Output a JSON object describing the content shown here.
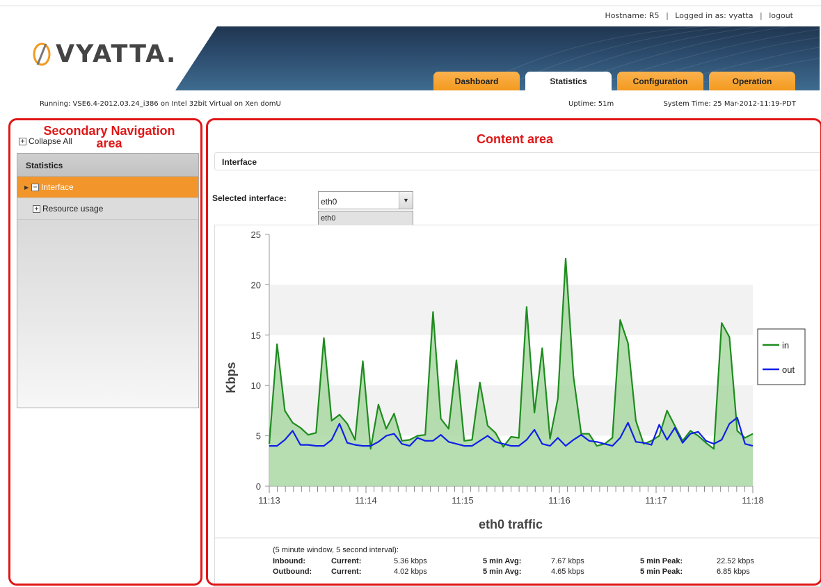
{
  "header": {
    "hostname": "Hostname: R5",
    "logged_in": "Logged in as: vyatta",
    "logout": "logout",
    "logo_text": "VYATTA.",
    "tabs": [
      {
        "label": "Dashboard",
        "active": false
      },
      {
        "label": "Statistics",
        "active": true
      },
      {
        "label": "Configuration",
        "active": false
      },
      {
        "label": "Operation",
        "active": false
      }
    ]
  },
  "status": {
    "running": "Running: VSE6.4-2012.03.24_i386 on Intel 32bit Virtual on Xen domU",
    "uptime": "Uptime: 51m",
    "system_time": "System Time: 25 Mar-2012-11:19-PDT"
  },
  "annotations": {
    "secondary_nav": "Secondary Navigation area",
    "content_area": "Content area"
  },
  "sidebar": {
    "collapse_all": "Collapse All",
    "heading": "Statistics",
    "items": [
      {
        "label": "Interface",
        "active": true
      },
      {
        "label": "Resource usage",
        "active": false
      }
    ]
  },
  "content": {
    "section_title": "Interface",
    "selected_label": "Selected interface:",
    "selected_value": "eth0",
    "dropdown_option": "eth0"
  },
  "colors": {
    "in": "#1e8c1e",
    "in_fill": "#a9d8a3",
    "out": "#1020e8",
    "tab_orange": "#f39a1f",
    "annotation": "#e01616"
  },
  "chart_data": {
    "type": "area",
    "title": "eth0 traffic",
    "ylabel": "Kbps",
    "xlabel": "",
    "ylim": [
      0,
      25
    ],
    "yticks": [
      0,
      5,
      10,
      15,
      20,
      25
    ],
    "xticks": [
      "11:13",
      "11:14",
      "11:15",
      "11:16",
      "11:17",
      "11:18"
    ],
    "xlim_minutes": [
      0,
      5
    ],
    "legend": "right",
    "grid": "alternating horizontal bands",
    "series": [
      {
        "name": "in",
        "values": [
          4.2,
          14.1,
          7.5,
          6.3,
          5.8,
          5.1,
          5.3,
          14.7,
          6.5,
          7.1,
          6.2,
          4.6,
          12.4,
          3.7,
          8.1,
          5.7,
          7.2,
          4.5,
          4.6,
          5.0,
          5.1,
          17.3,
          6.7,
          5.7,
          12.5,
          4.5,
          4.6,
          10.3,
          6.0,
          5.3,
          3.9,
          4.9,
          4.8,
          17.8,
          7.3,
          13.7,
          4.7,
          8.7,
          22.6,
          10.9,
          5.2,
          5.2,
          4.0,
          4.2,
          4.8,
          16.5,
          14.2,
          6.5,
          4.2,
          4.5,
          5.0,
          7.5,
          6.0,
          4.5,
          5.5,
          5.0,
          4.3,
          3.7,
          16.2,
          14.8,
          5.5,
          4.8,
          5.2
        ],
        "color": "#1e8c1e"
      },
      {
        "name": "out",
        "values": [
          4.0,
          4.0,
          4.6,
          5.5,
          4.1,
          4.1,
          4.0,
          4.0,
          4.6,
          6.2,
          4.3,
          4.1,
          4.0,
          4.0,
          4.4,
          5.0,
          5.2,
          4.2,
          4.0,
          4.8,
          4.5,
          4.5,
          5.1,
          4.4,
          4.2,
          4.0,
          4.0,
          4.5,
          5.0,
          4.4,
          4.2,
          4.0,
          4.0,
          4.6,
          5.6,
          4.2,
          4.0,
          4.8,
          4.0,
          4.6,
          5.1,
          4.5,
          4.4,
          4.2,
          4.0,
          4.8,
          6.3,
          4.4,
          4.3,
          4.1,
          6.1,
          4.6,
          5.8,
          4.3,
          5.2,
          5.4,
          4.5,
          4.2,
          4.6,
          6.2,
          6.8,
          4.2,
          4.0
        ],
        "color": "#1020e8"
      }
    ]
  },
  "stats": {
    "window": "(5 minute window, 5 second interval):",
    "rows": [
      {
        "label": "Inbound:",
        "current_label": "Current:",
        "current": "5.36 kbps",
        "avg_label": "5 min Avg:",
        "avg": "7.67 kbps",
        "peak_label": "5 min Peak:",
        "peak": "22.52 kbps"
      },
      {
        "label": "Outbound:",
        "current_label": "Current:",
        "current": "4.02 kbps",
        "avg_label": "5 min Avg:",
        "avg": "4.65 kbps",
        "peak_label": "5 min Peak:",
        "peak": "6.85 kbps"
      }
    ]
  }
}
